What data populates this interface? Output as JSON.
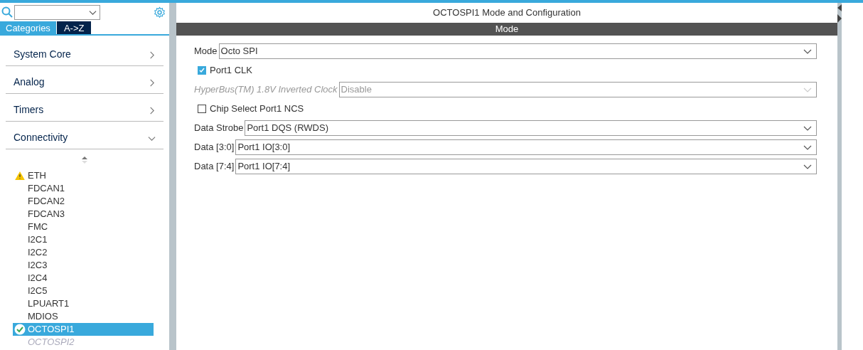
{
  "sidebar": {
    "tabs": [
      {
        "label": "Categories",
        "selected": true
      },
      {
        "label": "A->Z",
        "selected": false
      }
    ],
    "categories": [
      {
        "label": "System Core",
        "expanded": false
      },
      {
        "label": "Analog",
        "expanded": false
      },
      {
        "label": "Timers",
        "expanded": false
      },
      {
        "label": "Connectivity",
        "expanded": true
      }
    ],
    "items": [
      {
        "label": "ETH",
        "warning": true,
        "configured": false,
        "selected": false,
        "disabled": false
      },
      {
        "label": "FDCAN1",
        "warning": false,
        "configured": false,
        "selected": false,
        "disabled": false
      },
      {
        "label": "FDCAN2",
        "warning": false,
        "configured": false,
        "selected": false,
        "disabled": false
      },
      {
        "label": "FDCAN3",
        "warning": false,
        "configured": false,
        "selected": false,
        "disabled": false
      },
      {
        "label": "FMC",
        "warning": false,
        "configured": false,
        "selected": false,
        "disabled": false
      },
      {
        "label": "I2C1",
        "warning": false,
        "configured": false,
        "selected": false,
        "disabled": false
      },
      {
        "label": "I2C2",
        "warning": false,
        "configured": false,
        "selected": false,
        "disabled": false
      },
      {
        "label": "I2C3",
        "warning": false,
        "configured": false,
        "selected": false,
        "disabled": false
      },
      {
        "label": "I2C4",
        "warning": false,
        "configured": false,
        "selected": false,
        "disabled": false
      },
      {
        "label": "I2C5",
        "warning": false,
        "configured": false,
        "selected": false,
        "disabled": false
      },
      {
        "label": "LPUART1",
        "warning": false,
        "configured": false,
        "selected": false,
        "disabled": false
      },
      {
        "label": "MDIOS",
        "warning": false,
        "configured": false,
        "selected": false,
        "disabled": false
      },
      {
        "label": "OCTOSPI1",
        "warning": false,
        "configured": true,
        "selected": true,
        "disabled": false
      },
      {
        "label": "OCTOSPI2",
        "warning": false,
        "configured": false,
        "selected": false,
        "disabled": true
      }
    ]
  },
  "main": {
    "title": "OCTOSPI1 Mode and Configuration",
    "section": "Mode",
    "fields": [
      {
        "kind": "select",
        "label": "Mode",
        "value": "Octo SPI",
        "disabled": false
      },
      {
        "kind": "checkbox",
        "label": "Port1 CLK",
        "checked": true
      },
      {
        "kind": "select",
        "label": "HyperBus(TM) 1.8V Inverted Clock",
        "value": "Disable",
        "disabled": true
      },
      {
        "kind": "checkbox",
        "label": "Chip Select Port1 NCS",
        "checked": false
      },
      {
        "kind": "select",
        "label": "Data Strobe",
        "value": "Port1 DQS (RWDS)",
        "disabled": false
      },
      {
        "kind": "select",
        "label": "Data [3:0]",
        "value": "Port1 IO[3:0]",
        "disabled": false
      },
      {
        "kind": "select",
        "label": "Data [7:4]",
        "value": "Port1 IO[7:4]",
        "disabled": false
      }
    ]
  }
}
